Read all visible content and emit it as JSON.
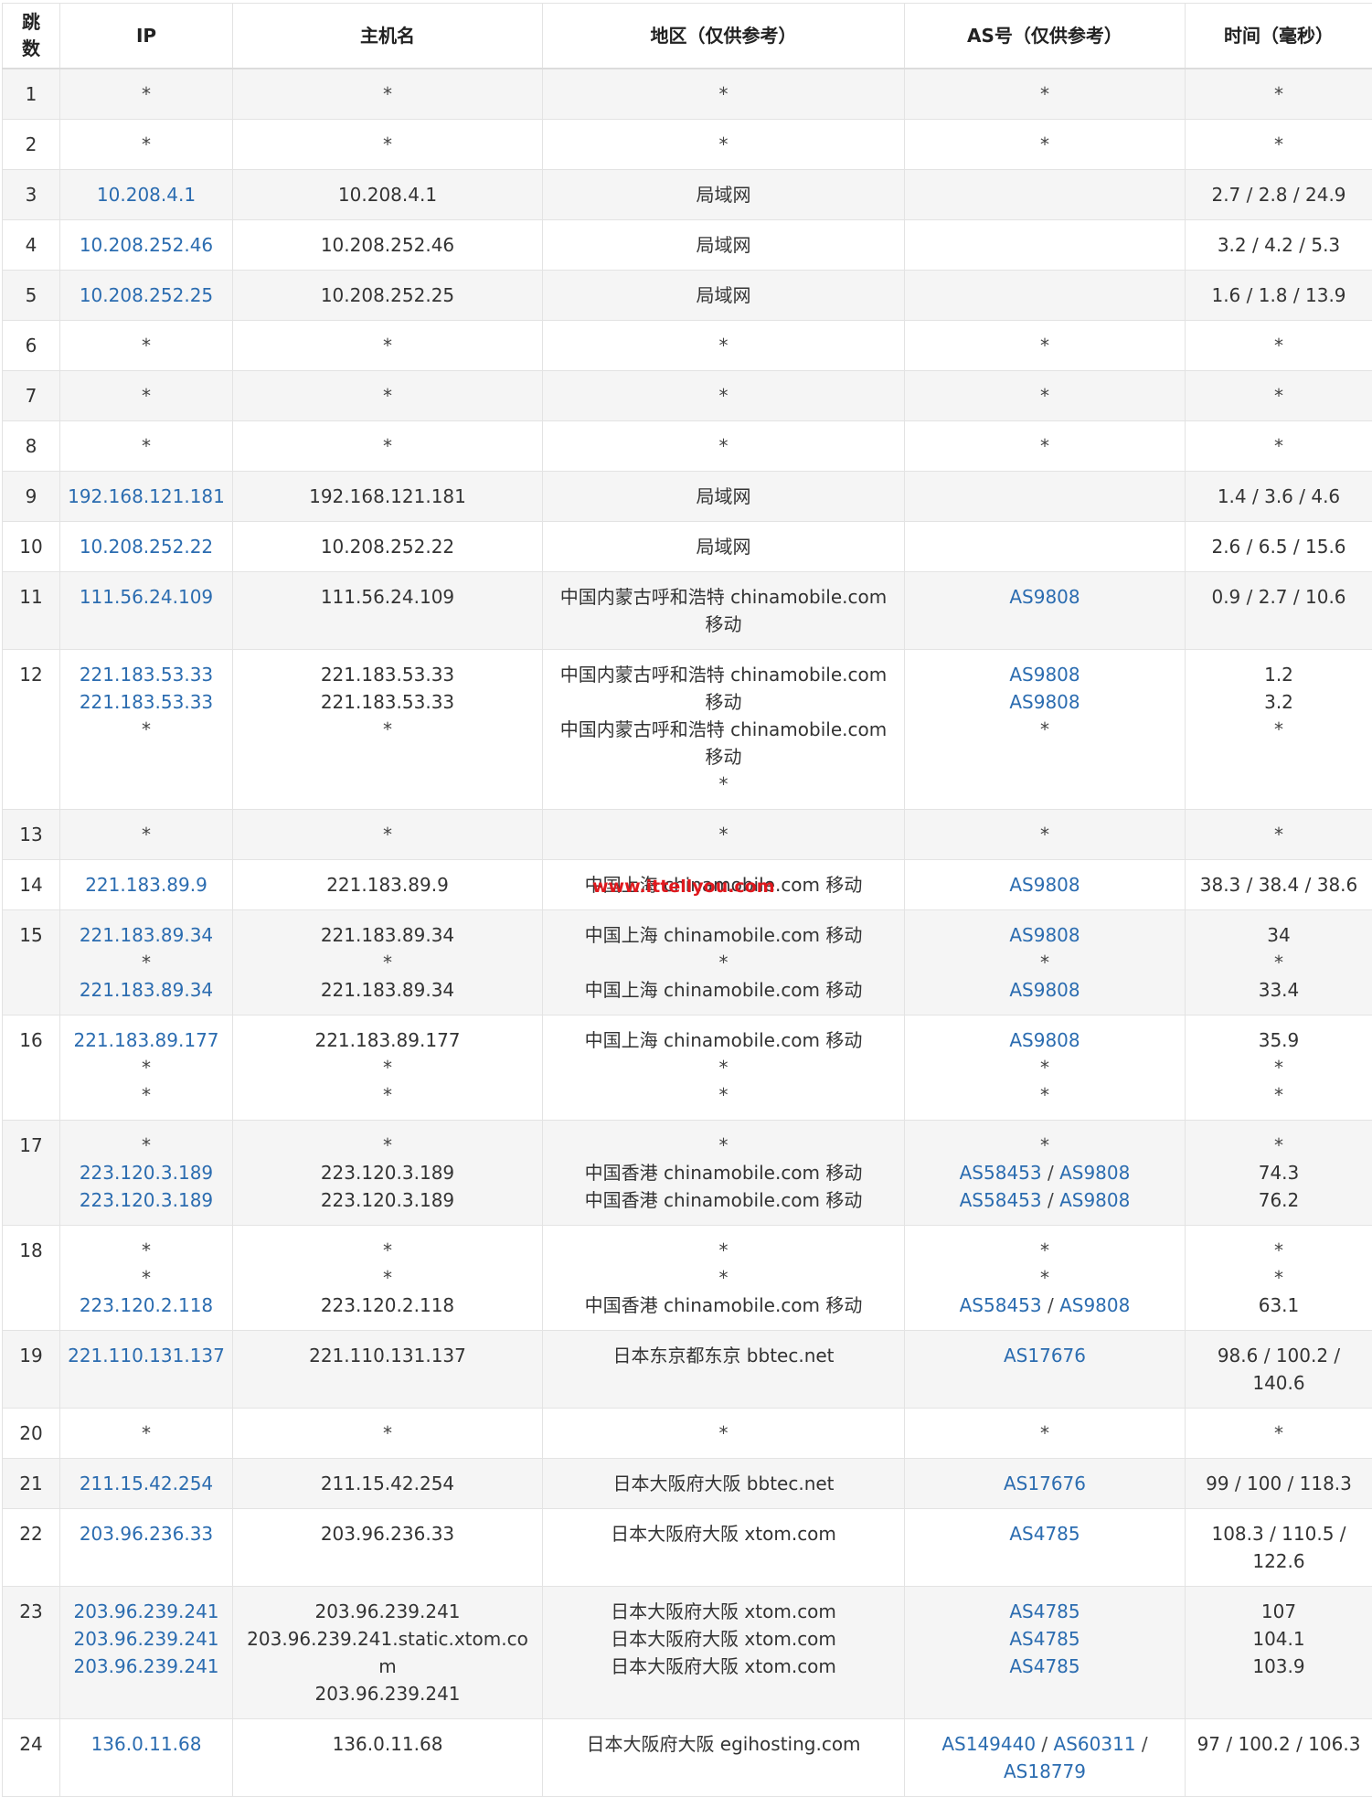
{
  "headers": [
    "跳\n数",
    "IP",
    "主机名",
    "地区（仅供参考）",
    "AS号（仅供参考）",
    "时间（毫秒）"
  ],
  "watermark": "www.ittellyou.com",
  "colors": {
    "link": "#2b6cb0",
    "watermark": "#e0191e",
    "row_alt": "#f5f5f5"
  },
  "rows": [
    {
      "hop": "1",
      "ip": [
        "*"
      ],
      "host": [
        "*"
      ],
      "region": [
        "*"
      ],
      "as": [
        [
          "*"
        ]
      ],
      "time": [
        "*"
      ]
    },
    {
      "hop": "2",
      "ip": [
        "*"
      ],
      "host": [
        "*"
      ],
      "region": [
        "*"
      ],
      "as": [
        [
          "*"
        ]
      ],
      "time": [
        "*"
      ]
    },
    {
      "hop": "3",
      "ip": [
        "10.208.4.1"
      ],
      "host": [
        "10.208.4.1"
      ],
      "region": [
        "局域网"
      ],
      "as": [
        []
      ],
      "time": [
        "2.7 / 2.8 / 24.9"
      ]
    },
    {
      "hop": "4",
      "ip": [
        "10.208.252.46"
      ],
      "host": [
        "10.208.252.46"
      ],
      "region": [
        "局域网"
      ],
      "as": [
        []
      ],
      "time": [
        "3.2 / 4.2 / 5.3"
      ]
    },
    {
      "hop": "5",
      "ip": [
        "10.208.252.25"
      ],
      "host": [
        "10.208.252.25"
      ],
      "region": [
        "局域网"
      ],
      "as": [
        []
      ],
      "time": [
        "1.6 / 1.8 / 13.9"
      ]
    },
    {
      "hop": "6",
      "ip": [
        "*"
      ],
      "host": [
        "*"
      ],
      "region": [
        "*"
      ],
      "as": [
        [
          "*"
        ]
      ],
      "time": [
        "*"
      ]
    },
    {
      "hop": "7",
      "ip": [
        "*"
      ],
      "host": [
        "*"
      ],
      "region": [
        "*"
      ],
      "as": [
        [
          "*"
        ]
      ],
      "time": [
        "*"
      ]
    },
    {
      "hop": "8",
      "ip": [
        "*"
      ],
      "host": [
        "*"
      ],
      "region": [
        "*"
      ],
      "as": [
        [
          "*"
        ]
      ],
      "time": [
        "*"
      ]
    },
    {
      "hop": "9",
      "ip": [
        "192.168.121.181"
      ],
      "host": [
        "192.168.121.181"
      ],
      "region": [
        "局域网"
      ],
      "as": [
        []
      ],
      "time": [
        "1.4 / 3.6 / 4.6"
      ]
    },
    {
      "hop": "10",
      "ip": [
        "10.208.252.22"
      ],
      "host": [
        "10.208.252.22"
      ],
      "region": [
        "局域网"
      ],
      "as": [
        []
      ],
      "time": [
        "2.6 / 6.5 / 15.6"
      ]
    },
    {
      "hop": "11",
      "ip": [
        "111.56.24.109"
      ],
      "host": [
        "111.56.24.109"
      ],
      "region": [
        "中国内蒙古呼和浩特 chinamobile.com\n移动"
      ],
      "as": [
        [
          "AS9808"
        ]
      ],
      "time": [
        "0.9 / 2.7 / 10.6"
      ]
    },
    {
      "hop": "12",
      "ip": [
        "221.183.53.33",
        "221.183.53.33",
        "*"
      ],
      "host": [
        "221.183.53.33",
        "221.183.53.33",
        "*"
      ],
      "region": [
        "中国内蒙古呼和浩特 chinamobile.com\n移动",
        "中国内蒙古呼和浩特 chinamobile.com\n移动",
        "*"
      ],
      "as": [
        [
          "AS9808"
        ],
        [
          "AS9808"
        ],
        [
          "*"
        ]
      ],
      "time": [
        "1.2",
        "3.2",
        "*"
      ]
    },
    {
      "hop": "13",
      "ip": [
        "*"
      ],
      "host": [
        "*"
      ],
      "region": [
        "*"
      ],
      "as": [
        [
          "*"
        ]
      ],
      "time": [
        "*"
      ]
    },
    {
      "hop": "14",
      "ip": [
        "221.183.89.9"
      ],
      "host": [
        "221.183.89.9"
      ],
      "region": [
        "中国上海 chinamobile.com 移动"
      ],
      "as": [
        [
          "AS9808"
        ]
      ],
      "time": [
        "38.3 / 38.4 / 38.6"
      ]
    },
    {
      "hop": "15",
      "ip": [
        "221.183.89.34",
        "*",
        "221.183.89.34"
      ],
      "host": [
        "221.183.89.34",
        "*",
        "221.183.89.34"
      ],
      "region": [
        "中国上海 chinamobile.com 移动",
        "*",
        "中国上海 chinamobile.com 移动"
      ],
      "as": [
        [
          "AS9808"
        ],
        [
          "*"
        ],
        [
          "AS9808"
        ]
      ],
      "time": [
        "34",
        "*",
        "33.4"
      ]
    },
    {
      "hop": "16",
      "ip": [
        "221.183.89.177",
        "*",
        "*"
      ],
      "host": [
        "221.183.89.177",
        "*",
        "*"
      ],
      "region": [
        "中国上海 chinamobile.com 移动",
        "*",
        "*"
      ],
      "as": [
        [
          "AS9808"
        ],
        [
          "*"
        ],
        [
          "*"
        ]
      ],
      "time": [
        "35.9",
        "*",
        "*"
      ]
    },
    {
      "hop": "17",
      "ip": [
        "*",
        "223.120.3.189",
        "223.120.3.189"
      ],
      "host": [
        "*",
        "223.120.3.189",
        "223.120.3.189"
      ],
      "region": [
        "*",
        "中国香港 chinamobile.com 移动",
        "中国香港 chinamobile.com 移动"
      ],
      "as": [
        [
          "*"
        ],
        [
          "AS58453",
          "AS9808"
        ],
        [
          "AS58453",
          "AS9808"
        ]
      ],
      "time": [
        "*",
        "74.3",
        "76.2"
      ]
    },
    {
      "hop": "18",
      "ip": [
        "*",
        "*",
        "223.120.2.118"
      ],
      "host": [
        "*",
        "*",
        "223.120.2.118"
      ],
      "region": [
        "*",
        "*",
        "中国香港 chinamobile.com 移动"
      ],
      "as": [
        [
          "*"
        ],
        [
          "*"
        ],
        [
          "AS58453",
          "AS9808"
        ]
      ],
      "time": [
        "*",
        "*",
        "63.1"
      ]
    },
    {
      "hop": "19",
      "ip": [
        "221.110.131.137"
      ],
      "host": [
        "221.110.131.137"
      ],
      "region": [
        "日本东京都东京 bbtec.net"
      ],
      "as": [
        [
          "AS17676"
        ]
      ],
      "time": [
        "98.6 / 100.2 /\n140.6"
      ]
    },
    {
      "hop": "20",
      "ip": [
        "*"
      ],
      "host": [
        "*"
      ],
      "region": [
        "*"
      ],
      "as": [
        [
          "*"
        ]
      ],
      "time": [
        "*"
      ]
    },
    {
      "hop": "21",
      "ip": [
        "211.15.42.254"
      ],
      "host": [
        "211.15.42.254"
      ],
      "region": [
        "日本大阪府大阪 bbtec.net"
      ],
      "as": [
        [
          "AS17676"
        ]
      ],
      "time": [
        "99 / 100 / 118.3"
      ]
    },
    {
      "hop": "22",
      "ip": [
        "203.96.236.33"
      ],
      "host": [
        "203.96.236.33"
      ],
      "region": [
        "日本大阪府大阪 xtom.com"
      ],
      "as": [
        [
          "AS4785"
        ]
      ],
      "time": [
        "108.3 / 110.5 /\n122.6"
      ]
    },
    {
      "hop": "23",
      "ip": [
        "203.96.239.241",
        "203.96.239.241",
        "203.96.239.241"
      ],
      "host": [
        "203.96.239.241",
        "203.96.239.241.static.xtom.com",
        "203.96.239.241"
      ],
      "region": [
        "日本大阪府大阪 xtom.com",
        "日本大阪府大阪 xtom.com",
        "日本大阪府大阪 xtom.com"
      ],
      "as": [
        [
          "AS4785"
        ],
        [
          "AS4785"
        ],
        [
          "AS4785"
        ]
      ],
      "time": [
        "107",
        "104.1",
        "103.9"
      ]
    },
    {
      "hop": "24",
      "ip": [
        "136.0.11.68"
      ],
      "host": [
        "136.0.11.68"
      ],
      "region": [
        "日本大阪府大阪 egihosting.com"
      ],
      "as": [
        [
          "AS149440",
          "AS60311",
          "AS18779"
        ]
      ],
      "time": [
        "97 / 100.2 / 106.3"
      ]
    }
  ]
}
